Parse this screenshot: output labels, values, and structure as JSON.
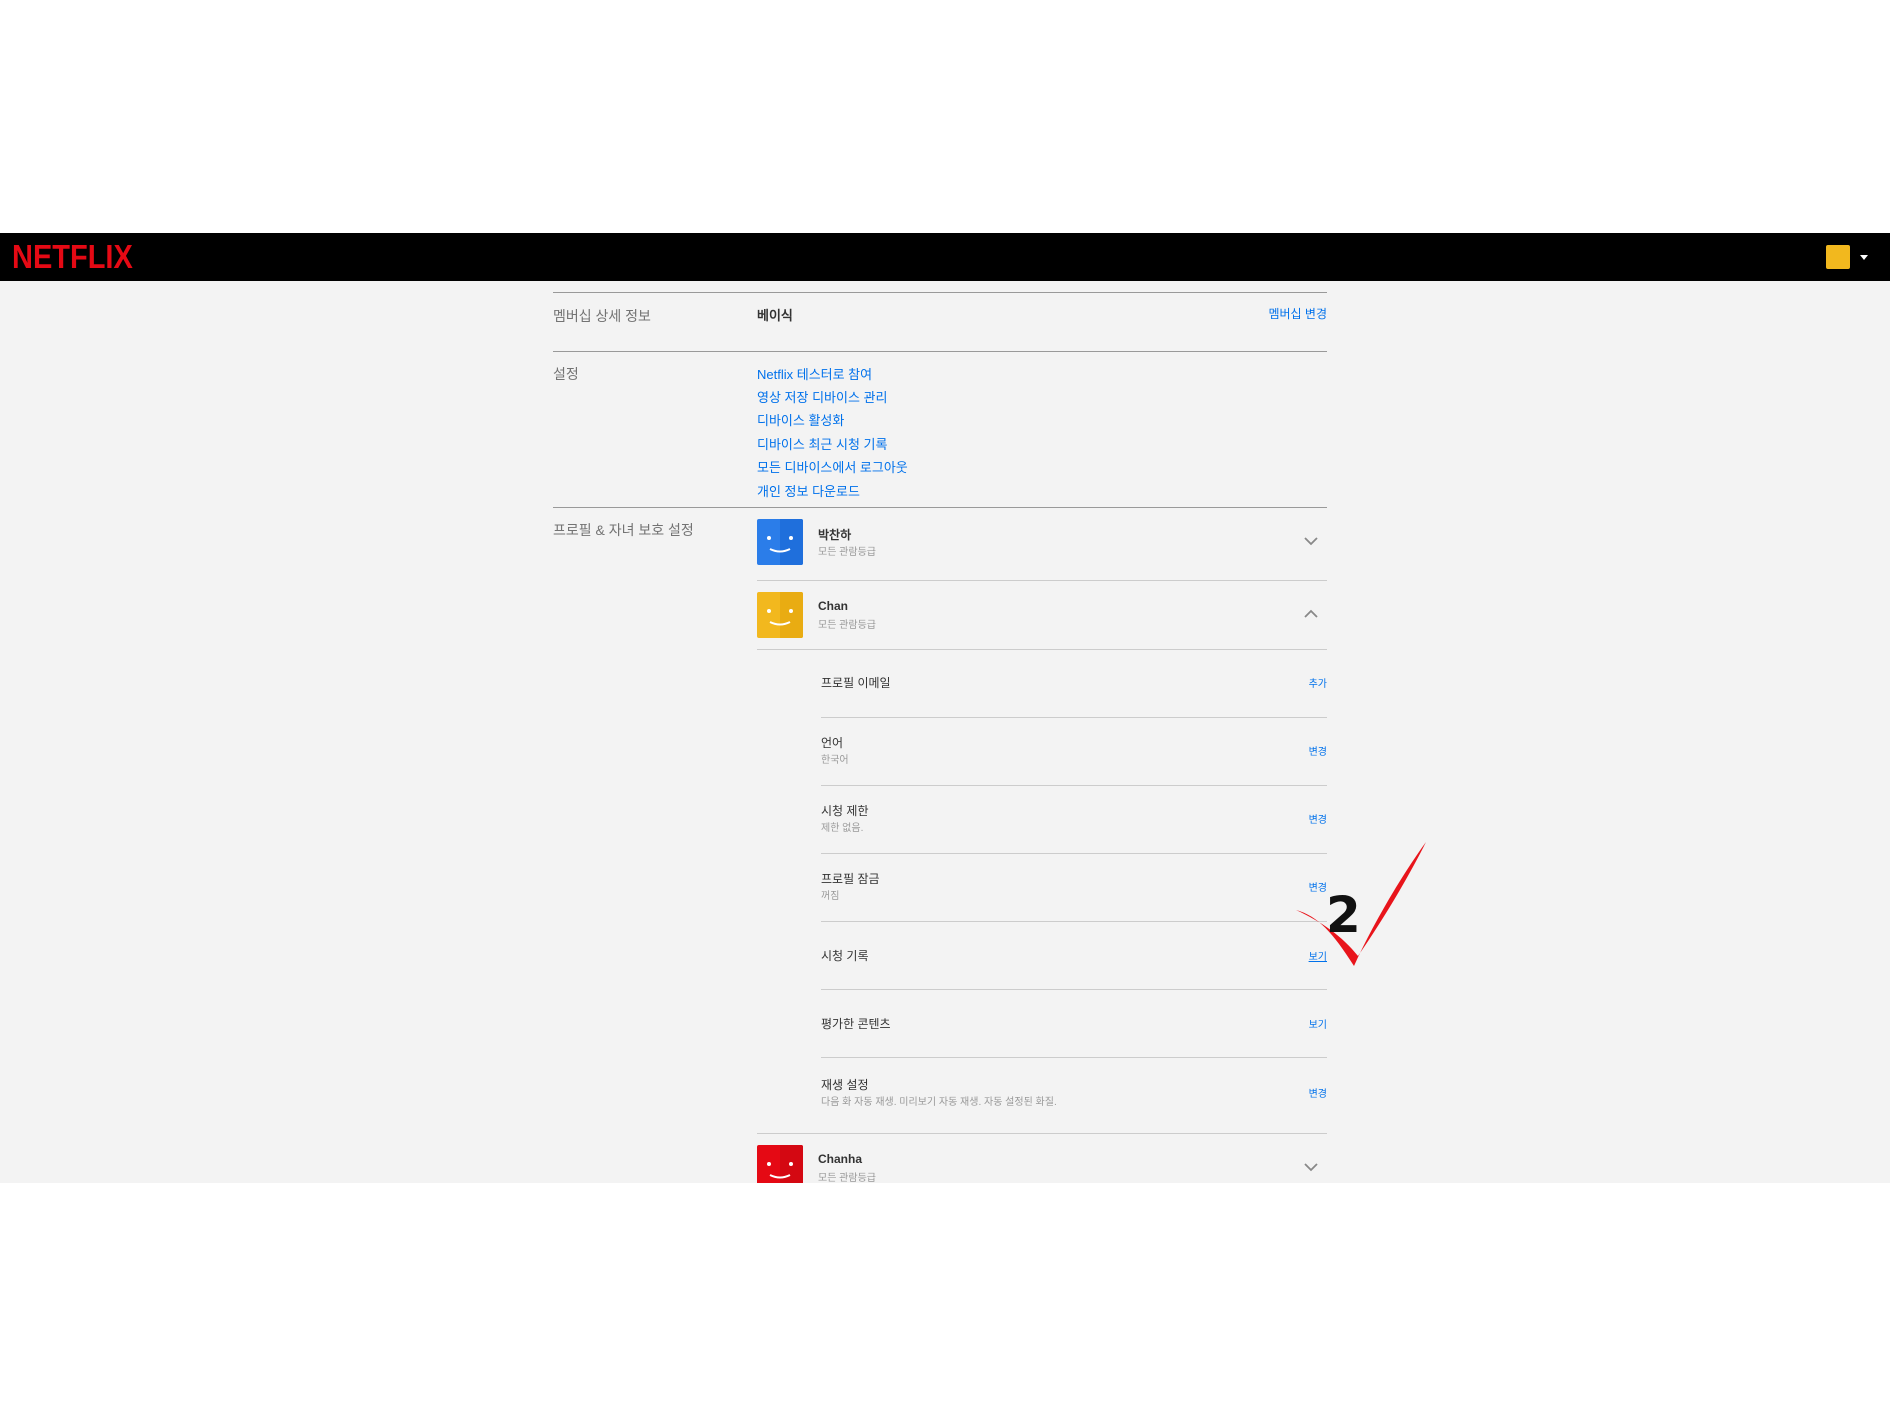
{
  "header": {
    "logo": "NETFLIX",
    "accent_color": "#e50914",
    "profile_icon": "avatar-yellow-icon"
  },
  "membership": {
    "label": "멤버십 상세 정보",
    "plan": "베이식",
    "change_link": "멤버십 변경"
  },
  "settings": {
    "label": "설정",
    "links": [
      "Netflix 테스터로 참여",
      "영상 저장 디바이스 관리",
      "디바이스 활성화",
      "디바이스 최근 시청 기록",
      "모든 디바이스에서 로그아웃",
      "개인 정보 다운로드"
    ]
  },
  "profiles": {
    "label": "프로필 & 자녀 보호 설정",
    "items": [
      {
        "name": "박찬하",
        "rating": "모든 관람등급",
        "color": "#2b7de9",
        "expanded": false
      },
      {
        "name": "Chan",
        "rating": "모든 관람등급",
        "color": "#f2b81e",
        "expanded": true
      },
      {
        "name": "Chanha",
        "rating": "모든 관람등급",
        "color": "#e50914",
        "expanded": false
      }
    ],
    "details": [
      {
        "title": "프로필 이메일",
        "sub": "",
        "action": "추가"
      },
      {
        "title": "언어",
        "sub": "한국어",
        "action": "변경"
      },
      {
        "title": "시청 제한",
        "sub": "제한 없음.",
        "action": "변경"
      },
      {
        "title": "프로필 잠금",
        "sub": "꺼짐",
        "action": "변경"
      },
      {
        "title": "시청 기록",
        "sub": "",
        "action": "보기"
      },
      {
        "title": "평가한 콘텐츠",
        "sub": "",
        "action": "보기"
      },
      {
        "title": "재생 설정",
        "sub": "다음 화 자동 재생. 미리보기 자동 재생. 자동 설정된 화질.",
        "action": "변경"
      }
    ]
  },
  "annotation": {
    "number": "2",
    "color": "#e8141b"
  }
}
